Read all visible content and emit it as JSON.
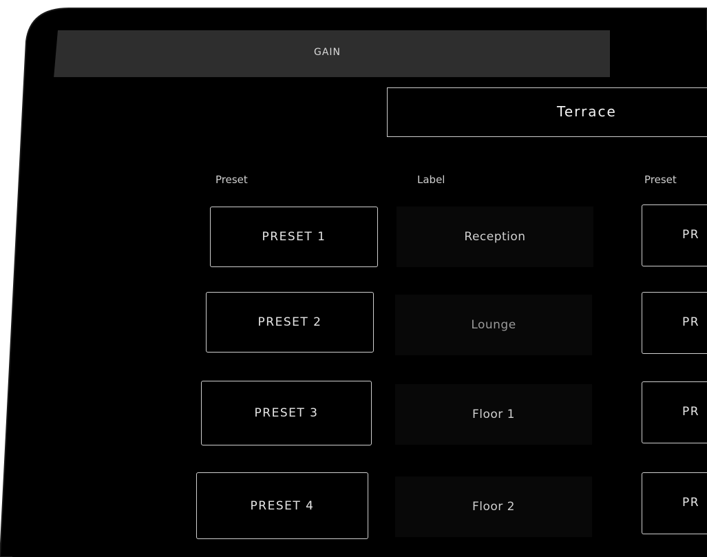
{
  "tabs": {
    "gain": "GAIN"
  },
  "room": {
    "name": "Terrace"
  },
  "columns": {
    "left_preset": "Preset",
    "left_label": "Label",
    "right_preset": "Preset"
  },
  "rows": [
    {
      "preset": "PRESET 1",
      "label": "Reception",
      "right_preset": "PR"
    },
    {
      "preset": "PRESET 2",
      "label": "Lounge",
      "right_preset": "PR"
    },
    {
      "preset": "PRESET 3",
      "label": "Floor 1",
      "right_preset": "PR"
    },
    {
      "preset": "PRESET 4",
      "label": "Floor 2",
      "right_preset": "PR"
    }
  ]
}
